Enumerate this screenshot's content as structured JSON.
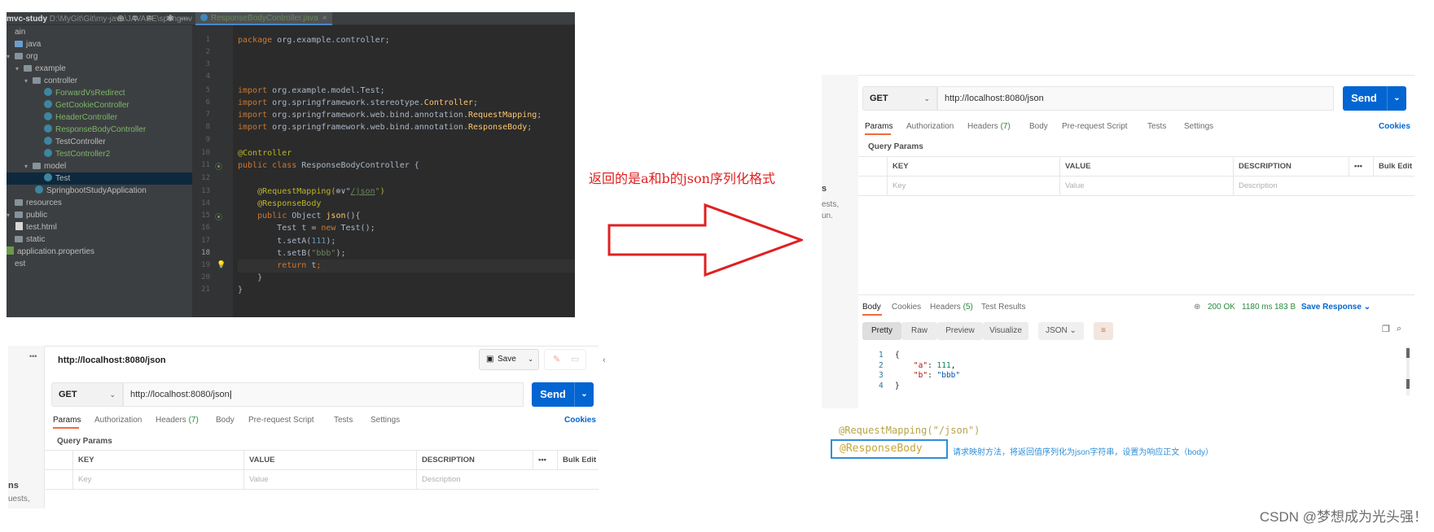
{
  "ide": {
    "project": {
      "name": "mvc-study",
      "path": "D:\\MyGit\\Git\\my-java\\JAVAEE\\springmv"
    },
    "tab": {
      "label": "ResponseBodyController.java",
      "close": "×"
    },
    "tree": [
      {
        "label": "ain",
        "type": "none",
        "indent": 0,
        "arrow": ""
      },
      {
        "label": "java",
        "type": "folder-blue",
        "indent": 0,
        "arrow": ""
      },
      {
        "label": "org",
        "type": "folder",
        "indent": 0,
        "arrow": "▾"
      },
      {
        "label": "example",
        "type": "folder",
        "indent": 1,
        "arrow": "▾"
      },
      {
        "label": "controller",
        "type": "folder",
        "indent": 2,
        "arrow": "▾"
      },
      {
        "label": "ForwardVsRedirect",
        "type": "class",
        "indent": 4,
        "green": true
      },
      {
        "label": "GetCookieController",
        "type": "class",
        "indent": 4,
        "green": true
      },
      {
        "label": "HeaderController",
        "type": "class",
        "indent": 4,
        "green": true
      },
      {
        "label": "ResponseBodyController",
        "type": "class",
        "indent": 4,
        "green": true
      },
      {
        "label": "TestController",
        "type": "class",
        "indent": 4,
        "green": false
      },
      {
        "label": "TestController2",
        "type": "class",
        "indent": 4,
        "green": true
      },
      {
        "label": "model",
        "type": "folder",
        "indent": 2,
        "arrow": "▾"
      },
      {
        "label": "Test",
        "type": "class",
        "indent": 4,
        "green": false,
        "selected": true
      },
      {
        "label": "SpringbootStudyApplication",
        "type": "class",
        "indent": 3,
        "green": false
      },
      {
        "label": "resources",
        "type": "folder",
        "indent": 0,
        "arrow": ""
      },
      {
        "label": "public",
        "type": "folder",
        "indent": 0,
        "arrow": "▾"
      },
      {
        "label": "test.html",
        "type": "leaf",
        "indent": 1
      },
      {
        "label": "static",
        "type": "folder",
        "indent": 0,
        "arrow": ""
      },
      {
        "label": "application.properties",
        "type": "prop",
        "indent": 0
      },
      {
        "label": "est",
        "type": "none",
        "indent": 0,
        "arrow": ""
      }
    ],
    "line_numbers": [
      "1",
      "2",
      "3",
      "4",
      "5",
      "6",
      "7",
      "8",
      "9",
      "10",
      "11",
      "12",
      "13",
      "14",
      "15",
      "16",
      "17",
      "18",
      "19",
      "20",
      "21"
    ],
    "current_line": "18",
    "code": {
      "l1": {
        "kw": "package",
        "rest": " org.example.controller;"
      },
      "l4a": "import ",
      "l4b": "org.example.model.Test;",
      "l5a": "import ",
      "l5b": "org.springframework.stereotype.",
      "l5c": "Controller",
      "l5d": ";",
      "l6a": "import ",
      "l6b": "org.springframework.web.bind.annotation.",
      "l6c": "RequestMapping",
      "l6d": ";",
      "l7a": "import ",
      "l7b": "org.springframework.web.bind.annotation.",
      "l7c": "ResponseBody",
      "l7d": ";",
      "l9": "@Controller",
      "l10a": "public class ",
      "l10b": "ResponseBodyController {",
      "l12a": "@RequestMapping(",
      "l12b": "⊚∨\"",
      "l12c": "/json",
      "l12d": "\"",
      "l12e": ")",
      "l13": "@ResponseBody",
      "l14a": "public ",
      "l14b": "Object ",
      "l14c": "json",
      "l14d": "(){",
      "l15a": "Test ",
      "l15b": "t",
      "l15c": " = ",
      "l15d": "new ",
      "l15e": "Test();",
      "l16a": "t",
      "l16b": ".setA(",
      "l16c": "111",
      "l16d": ");",
      "l17a": "t",
      "l17b": ".setB(",
      "l17c": "\"bbb\"",
      "l17d": ");",
      "l18a": "return ",
      "l18b": "t",
      "l18c": ";",
      "l19": "}",
      "l20": "}"
    }
  },
  "annotation": {
    "text": "返回的是a和b的json序列化格式"
  },
  "arrow": {
    "color": "#e02020"
  },
  "postman_left": {
    "title": "http://localhost:8080/json",
    "save_label": "Save",
    "method": "GET",
    "url": "http://localhost:8080/json",
    "send_label": "Send",
    "tabs": [
      {
        "label": "Params",
        "active": true
      },
      {
        "label": "Authorization"
      },
      {
        "label": "Headers",
        "count": "(7)"
      },
      {
        "label": "Body"
      },
      {
        "label": "Pre-request Script"
      },
      {
        "label": "Tests"
      },
      {
        "label": "Settings"
      }
    ],
    "cookies": "Cookies",
    "query_params": "Query Params",
    "table": {
      "key": "KEY",
      "value": "VALUE",
      "description": "DESCRIPTION",
      "more": "•••",
      "bulk_edit": "Bulk Edit",
      "ph_key": "Key",
      "ph_value": "Value",
      "ph_description": "Description"
    },
    "side_fragments": [
      "ns",
      "uests,"
    ]
  },
  "postman_right": {
    "method": "GET",
    "url": "http://localhost:8080/json",
    "send_label": "Send",
    "tabs": [
      {
        "label": "Params",
        "active": true
      },
      {
        "label": "Authorization"
      },
      {
        "label": "Headers",
        "count": "(7)"
      },
      {
        "label": "Body"
      },
      {
        "label": "Pre-request Script"
      },
      {
        "label": "Tests"
      },
      {
        "label": "Settings"
      }
    ],
    "cookies": "Cookies",
    "query_params": "Query Params",
    "table": {
      "key": "KEY",
      "value": "VALUE",
      "description": "DESCRIPTION",
      "more": "•••",
      "bulk_edit": "Bulk Edit",
      "ph_key": "Key",
      "ph_value": "Value",
      "ph_description": "Description"
    },
    "side_fragments": [
      "s",
      "ests,",
      "un."
    ],
    "response": {
      "tabs": [
        {
          "label": "Body",
          "active": true
        },
        {
          "label": "Cookies"
        },
        {
          "label": "Headers",
          "count": "(5)"
        },
        {
          "label": "Test Results"
        }
      ],
      "status": "200 OK",
      "time": "1180 ms",
      "size": "183 B",
      "save_response": "Save Response",
      "views": [
        "Pretty",
        "Raw",
        "Preview",
        "Visualize"
      ],
      "format": "JSON",
      "json_lines": [
        {
          "n": "1",
          "text": "{"
        },
        {
          "n": "2",
          "key": "\"a\"",
          "sep": ": ",
          "val": "111",
          "tail": ",",
          "kind": "num"
        },
        {
          "n": "3",
          "key": "\"b\"",
          "sep": ": ",
          "val": "\"bbb\"",
          "tail": "",
          "kind": "str"
        },
        {
          "n": "4",
          "text": "}"
        }
      ]
    }
  },
  "snippet": {
    "code_top": "@RequestMapping(\"/json\")",
    "annotation": "@ResponseBody",
    "description": "请求映射方法，将返回值序列化为json字符串，设置为响应正文（body）"
  },
  "watermark": "CSDN @梦想成为光头强！"
}
